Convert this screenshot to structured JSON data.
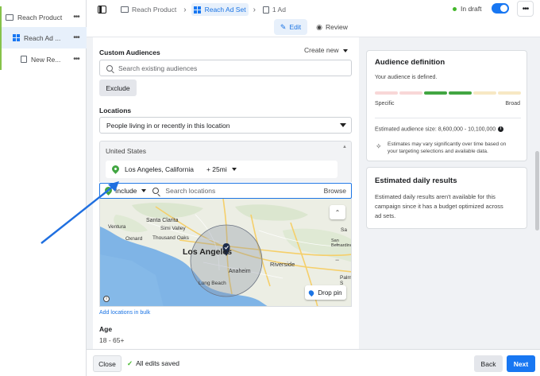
{
  "tree": {
    "items": [
      {
        "label": "Reach Product",
        "icon": "folder-icon"
      },
      {
        "label": "Reach Ad ...",
        "icon": "ad-set-grid-icon"
      },
      {
        "label": "New Re...",
        "icon": "ad-document-icon"
      }
    ]
  },
  "header": {
    "breadcrumbs": [
      {
        "label": "Reach Product"
      },
      {
        "label": "Reach Ad Set"
      },
      {
        "label": "1 Ad"
      }
    ],
    "status": "In draft",
    "modes": {
      "edit": "Edit",
      "review": "Review"
    }
  },
  "form": {
    "custom_audiences": {
      "label": "Custom Audiences",
      "create_new": "Create new",
      "search_placeholder": "Search existing audiences",
      "exclude_label": "Exclude"
    },
    "locations": {
      "label": "Locations",
      "select_value": "People living in or recently in this location",
      "country": "United States",
      "location": {
        "name": "Los Angeles, California",
        "radius": "+ 25mi"
      },
      "include_label": "Include",
      "search_placeholder": "Search locations",
      "browse_label": "Browse",
      "map": {
        "labels": {
          "santa_clarita": "Santa Clarita",
          "los_angeles": "Los Angeles",
          "oxnard": "Oxnard",
          "thousand_oaks": "Thousand Oaks",
          "simi_valley": "Simi Valley",
          "riverside": "Riverside",
          "anaheim": "Anaheim",
          "long_beach": "Long Beach",
          "san_bernardino": "San Bernardino",
          "palm_springs": "Palm S",
          "ventura": "Ventura",
          "sa": "Sa",
          "zoom_in": "+",
          "zoom_out": "−"
        },
        "drop_pin": "Drop pin"
      },
      "add_bulk": "Add locations in bulk"
    },
    "age": {
      "label": "Age",
      "value": "18 - 65+"
    }
  },
  "audience_definition": {
    "title": "Audience definition",
    "defined_text": "Your audience is defined.",
    "meter_left": "Specific",
    "meter_right": "Broad",
    "meter_colors": [
      "#f8d7d7",
      "#f8d7d7",
      "#42a642",
      "#42a642",
      "#f7e8c4",
      "#f7e8c4"
    ],
    "estimated_size": "Estimated audience size: 8,600,000 - 10,100,000",
    "disclaimer_line1": "Estimates may vary significantly over time based on",
    "disclaimer_line2": "your targeting selections and available data."
  },
  "daily_results": {
    "title": "Estimated daily results",
    "line1": "Estimated daily results aren't available for this",
    "line2": "campaign since it has a budget optimized across",
    "line3": "ad sets."
  },
  "footer": {
    "close": "Close",
    "saved": "All edits saved",
    "back": "Back",
    "next": "Next"
  },
  "colors": {
    "accent": "#1877f2",
    "status_green": "#42b72a",
    "pin_green": "#42a642"
  }
}
